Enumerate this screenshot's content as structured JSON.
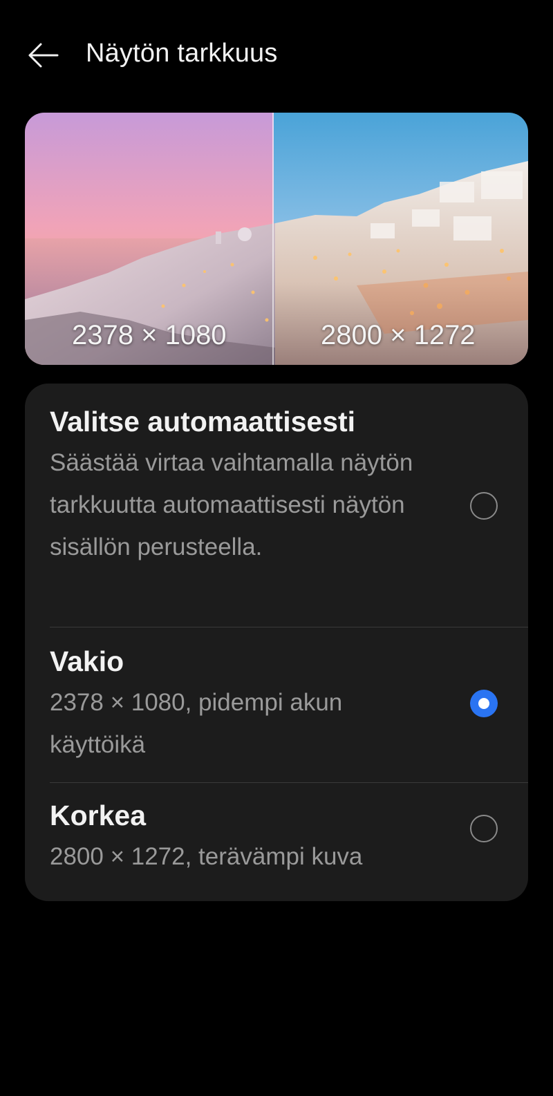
{
  "header": {
    "title": "Näytön tarkkuus",
    "back_icon": "arrow-left-icon"
  },
  "preview": {
    "left_label": "2378 × 1080",
    "right_label": "2800 × 1272"
  },
  "options": [
    {
      "title": "Valitse automaattisesti",
      "description": "Säästää virtaa vaihtamalla näytön tarkkuutta automaattisesti näytön sisällön perusteella.",
      "selected": false
    },
    {
      "title": "Vakio",
      "description": "2378 × 1080, pidempi akun käyttöikä",
      "selected": true
    },
    {
      "title": "Korkea",
      "description": "2800 × 1272, terävämpi kuva",
      "selected": false
    }
  ],
  "colors": {
    "accent": "#2a74f2",
    "card_background": "#1c1c1c",
    "page_background": "#000000"
  }
}
